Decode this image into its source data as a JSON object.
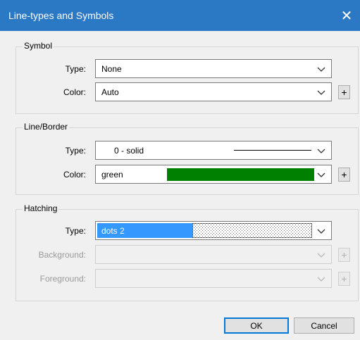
{
  "window": {
    "title": "Line-types and Symbols",
    "close_glyph": "✕"
  },
  "symbol": {
    "group_label": "Symbol",
    "type_label": "Type:",
    "type_value": "None",
    "color_label": "Color:",
    "color_value": "Auto",
    "add_glyph": "+"
  },
  "line_border": {
    "group_label": "Line/Border",
    "type_label": "Type:",
    "type_value": "0 - solid",
    "color_label": "Color:",
    "color_value": "green",
    "swatch_color": "#008000",
    "add_glyph": "+"
  },
  "hatching": {
    "group_label": "Hatching",
    "type_label": "Type:",
    "type_value": "dots 2",
    "selection_color": "#3399ff",
    "background_label": "Background:",
    "foreground_label": "Foreground:",
    "add_glyph": "+"
  },
  "buttons": {
    "ok": "OK",
    "cancel": "Cancel"
  }
}
